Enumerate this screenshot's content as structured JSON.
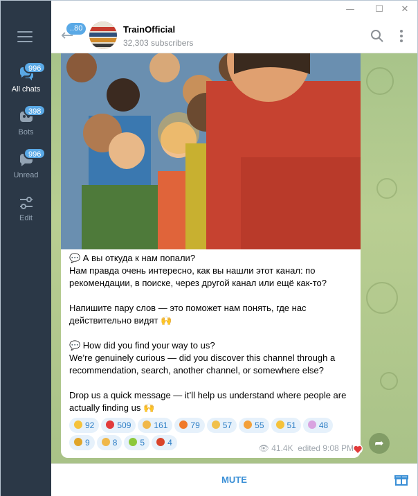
{
  "window": {
    "minimize": "—",
    "maximize": "☐",
    "close": "✕"
  },
  "sidebar": {
    "folders": [
      {
        "label": "All chats",
        "badge": "996",
        "icon": "chat-bubbles-icon",
        "active": true
      },
      {
        "label": "Bots",
        "badge": "398",
        "icon": "bot-icon",
        "active": false
      },
      {
        "label": "Unread",
        "badge": "996",
        "icon": "chat-bubble-icon",
        "active": false
      },
      {
        "label": "Edit",
        "badge": "",
        "icon": "sliders-icon",
        "active": false
      }
    ]
  },
  "header": {
    "back_badge": "..80",
    "title": "TrainOfficial",
    "subtitle": "32,303 subscribers"
  },
  "post": {
    "paragraphs": [
      "💬 А вы откуда к нам попали?\nНам правда очень интересно, как вы нашли этот канал: по рекомендации, в поиске, через другой канал или ещё как-то?",
      "Напишите пару слов — это поможет нам понять, где нас действительно видят 🙌",
      "💬 How did you find your way to us?\nWe’re genuinely curious — did you discover this channel through a recommendation, search, another channel, or somewhere else?",
      "Drop us a quick message — it’ll help us understand where people are actually finding us 🙌"
    ],
    "reactions": [
      {
        "emoji": "😂",
        "count": "92",
        "color": "#f5c23b"
      },
      {
        "emoji": "❤️",
        "count": "509",
        "color": "#e23b3b"
      },
      {
        "emoji": "👍",
        "count": "161",
        "color": "#f0b84a"
      },
      {
        "emoji": "🔥",
        "count": "79",
        "color": "#f07a2a"
      },
      {
        "emoji": "👏",
        "count": "57",
        "color": "#f1c04a"
      },
      {
        "emoji": "🥰",
        "count": "55",
        "color": "#f3a03a"
      },
      {
        "emoji": "🤩",
        "count": "51",
        "color": "#f5c23b"
      },
      {
        "emoji": "🎉",
        "count": "48",
        "color": "#d9a3e0"
      },
      {
        "emoji": "🏆",
        "count": "9",
        "color": "#e0a52a"
      },
      {
        "emoji": "👎",
        "count": "8",
        "color": "#f0b84a"
      },
      {
        "emoji": "🤮",
        "count": "5",
        "color": "#8cc83b"
      },
      {
        "emoji": "🤬",
        "count": "4",
        "color": "#d9442a"
      }
    ],
    "views": "41.4K",
    "edited": "edited 9:08 PM"
  },
  "footer": {
    "mute_label": "MUTE"
  }
}
